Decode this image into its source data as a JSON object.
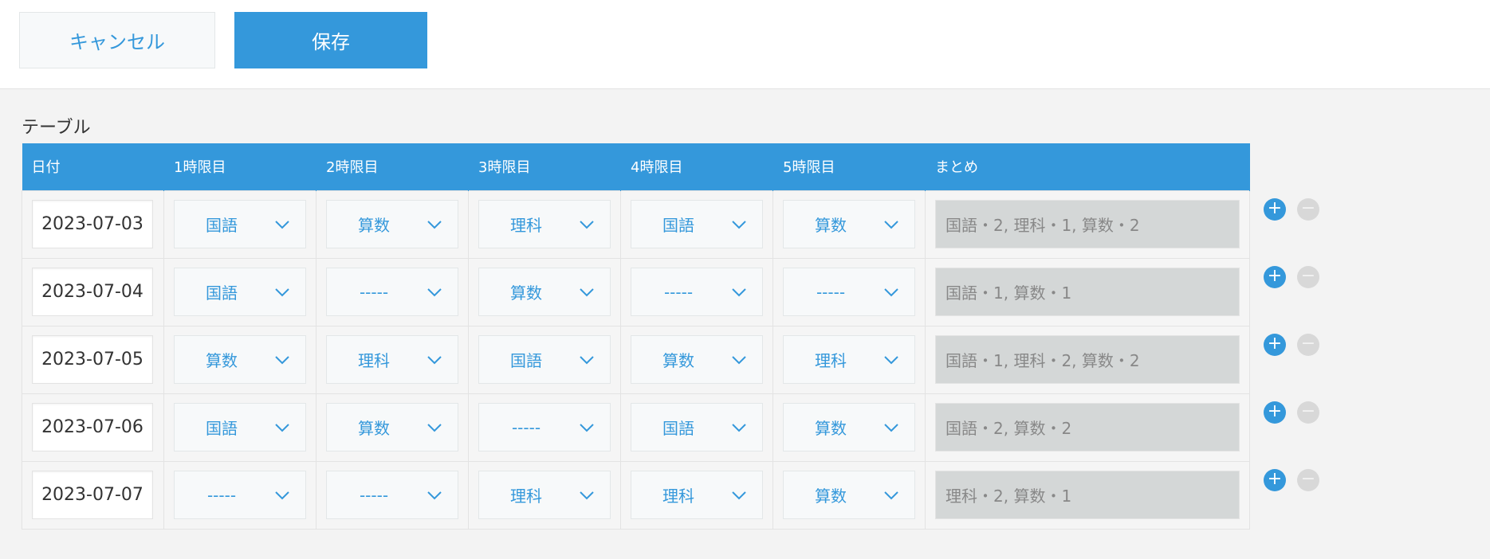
{
  "toolbar": {
    "cancel_label": "キャンセル",
    "save_label": "保存"
  },
  "table": {
    "label": "テーブル",
    "headers": [
      "日付",
      "1時限目",
      "2時限目",
      "3時限目",
      "4時限目",
      "5時限目",
      "まとめ"
    ],
    "rows": [
      {
        "date": "2023-07-03",
        "periods": [
          "国語",
          "算数",
          "理科",
          "国語",
          "算数"
        ],
        "summary": "国語・2, 理科・1, 算数・2"
      },
      {
        "date": "2023-07-04",
        "periods": [
          "国語",
          "-----",
          "算数",
          "-----",
          "-----"
        ],
        "summary": "国語・1, 算数・1"
      },
      {
        "date": "2023-07-05",
        "periods": [
          "算数",
          "理科",
          "国語",
          "算数",
          "理科"
        ],
        "summary": "国語・1, 理科・2, 算数・2"
      },
      {
        "date": "2023-07-06",
        "periods": [
          "国語",
          "算数",
          "-----",
          "国語",
          "算数"
        ],
        "summary": "国語・2, 算数・2"
      },
      {
        "date": "2023-07-07",
        "periods": [
          "-----",
          "-----",
          "理科",
          "理科",
          "算数"
        ],
        "summary": "理科・2, 算数・1"
      }
    ]
  },
  "row_actions": {
    "add_symbol": "+",
    "remove_symbol": "−"
  },
  "colors": {
    "accent": "#3498db",
    "summary_bg": "#d4d7d7",
    "page_bg": "#f3f3f3"
  },
  "icons": {
    "dropdown": "chevron-down-icon",
    "add": "plus-icon",
    "remove": "minus-icon"
  }
}
